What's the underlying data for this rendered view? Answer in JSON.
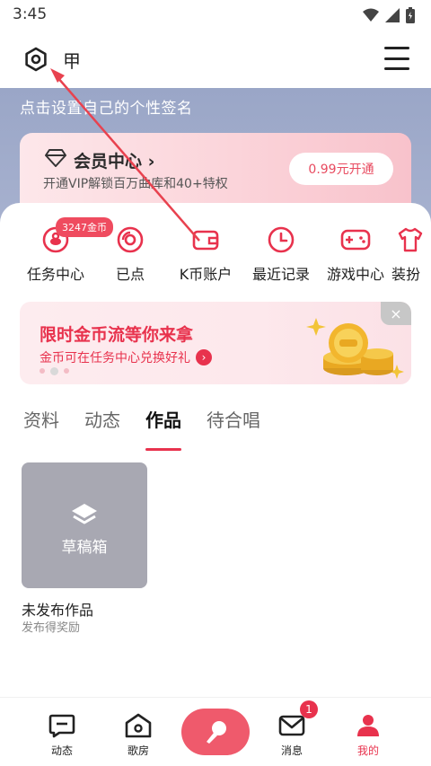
{
  "status_bar": {
    "time": "3:45"
  },
  "header": {
    "username": "甲"
  },
  "profile": {
    "signature_placeholder": "点击设置自己的个性签名"
  },
  "vip": {
    "title": "会员中心 ›",
    "subtitle": "开通VIP解锁百万曲库和40+特权",
    "button_label": "0.99元开通"
  },
  "entries": {
    "coin_badge": "3247金币",
    "items": [
      {
        "label": "任务中心",
        "icon": "task-icon"
      },
      {
        "label": "已点",
        "icon": "disc-icon"
      },
      {
        "label": "K币账户",
        "icon": "wallet-icon"
      },
      {
        "label": "最近记录",
        "icon": "clock-icon"
      },
      {
        "label": "游戏中心",
        "icon": "gamepad-icon"
      },
      {
        "label": "装扮",
        "icon": "shirt-icon"
      }
    ]
  },
  "promo": {
    "title": "限时金币流等你来拿",
    "subtitle": "金币可在任务中心兑换好礼",
    "close": "×"
  },
  "tabs": [
    {
      "label": "资料",
      "active": false
    },
    {
      "label": "动态",
      "active": false
    },
    {
      "label": "作品",
      "active": true
    },
    {
      "label": "待合唱",
      "active": false
    }
  ],
  "drafts": {
    "box_label": "草稿箱",
    "title": "未发布作品",
    "subtitle": "发布得奖励"
  },
  "bottom_nav": {
    "items": [
      {
        "label": "动态",
        "icon": "message-square-icon"
      },
      {
        "label": "歌房",
        "icon": "house-icon"
      },
      {
        "label": "消息",
        "icon": "mail-icon"
      },
      {
        "label": "我的",
        "icon": "person-icon"
      }
    ],
    "message_badge": "1"
  },
  "colors": {
    "accent": "#e8324d",
    "band": "#a3adcc",
    "vip_card": "#fbd4da"
  }
}
